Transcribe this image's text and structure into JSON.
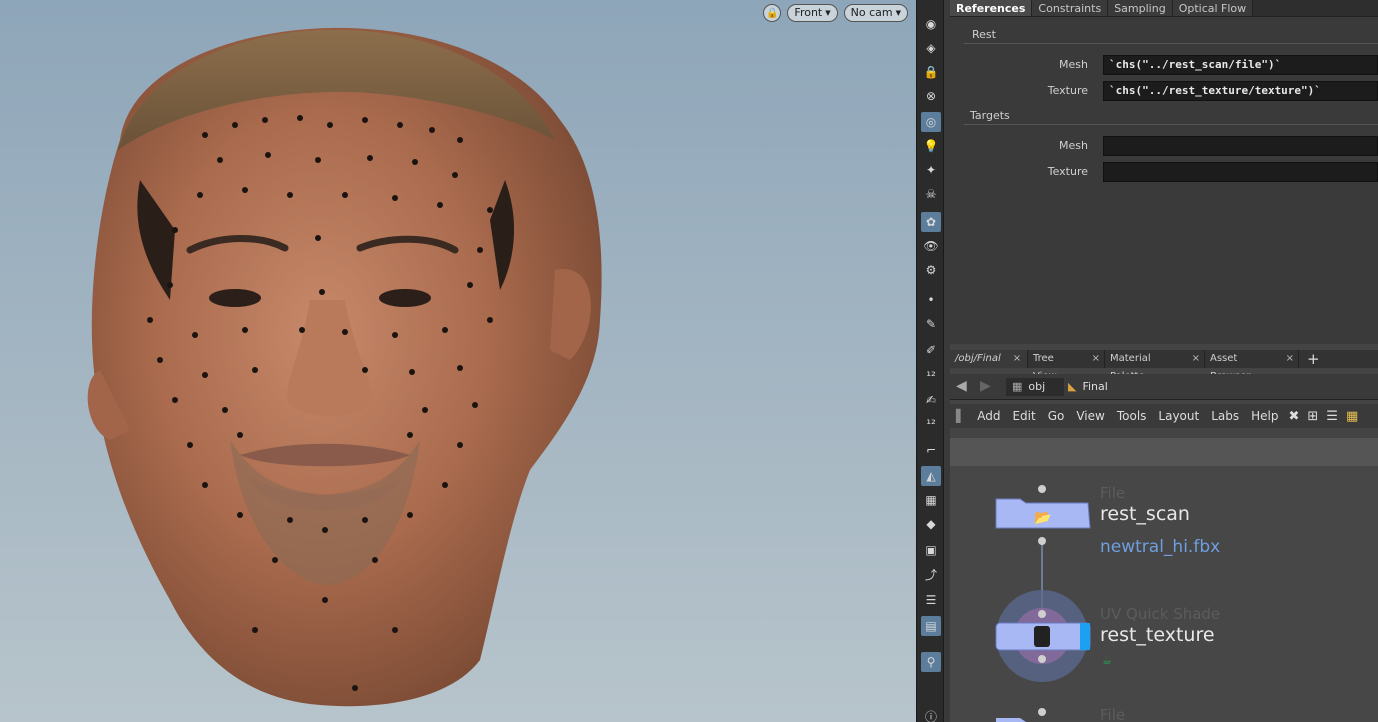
{
  "viewport": {
    "view_label": "Front",
    "camera_label": "No cam",
    "lock_icon": "lock-icon"
  },
  "params": {
    "tabs": [
      {
        "label": "References",
        "active": true
      },
      {
        "label": "Constraints",
        "active": false
      },
      {
        "label": "Sampling",
        "active": false
      },
      {
        "label": "Optical Flow",
        "active": false
      }
    ],
    "rest": {
      "title": "Rest",
      "mesh_label": "Mesh",
      "mesh_value": "`chs(\"../rest_scan/file\")`",
      "texture_label": "Texture",
      "texture_value": "`chs(\"../rest_texture/texture\")`"
    },
    "targets": {
      "title": "Targets",
      "mesh_label": "Mesh",
      "mesh_value": "",
      "texture_label": "Texture",
      "texture_value": ""
    }
  },
  "network": {
    "tabs": [
      {
        "label": "/obj/Final",
        "active": true
      },
      {
        "label": "Tree View",
        "active": false
      },
      {
        "label": "Material Palette",
        "active": false
      },
      {
        "label": "Asset Browser",
        "active": false
      }
    ],
    "add_tab": "+",
    "path": {
      "root": "obj",
      "current": "Final"
    },
    "menu": [
      "Add",
      "Edit",
      "Go",
      "View",
      "Tools",
      "Layout",
      "Labs",
      "Help"
    ],
    "nodes": [
      {
        "type": "File",
        "name": "rest_scan",
        "parm": "newtral_hi.fbx"
      },
      {
        "type": "UV Quick Shade",
        "name": "rest_texture",
        "parm": ""
      },
      {
        "type": "File",
        "name": "",
        "parm": ""
      }
    ]
  }
}
